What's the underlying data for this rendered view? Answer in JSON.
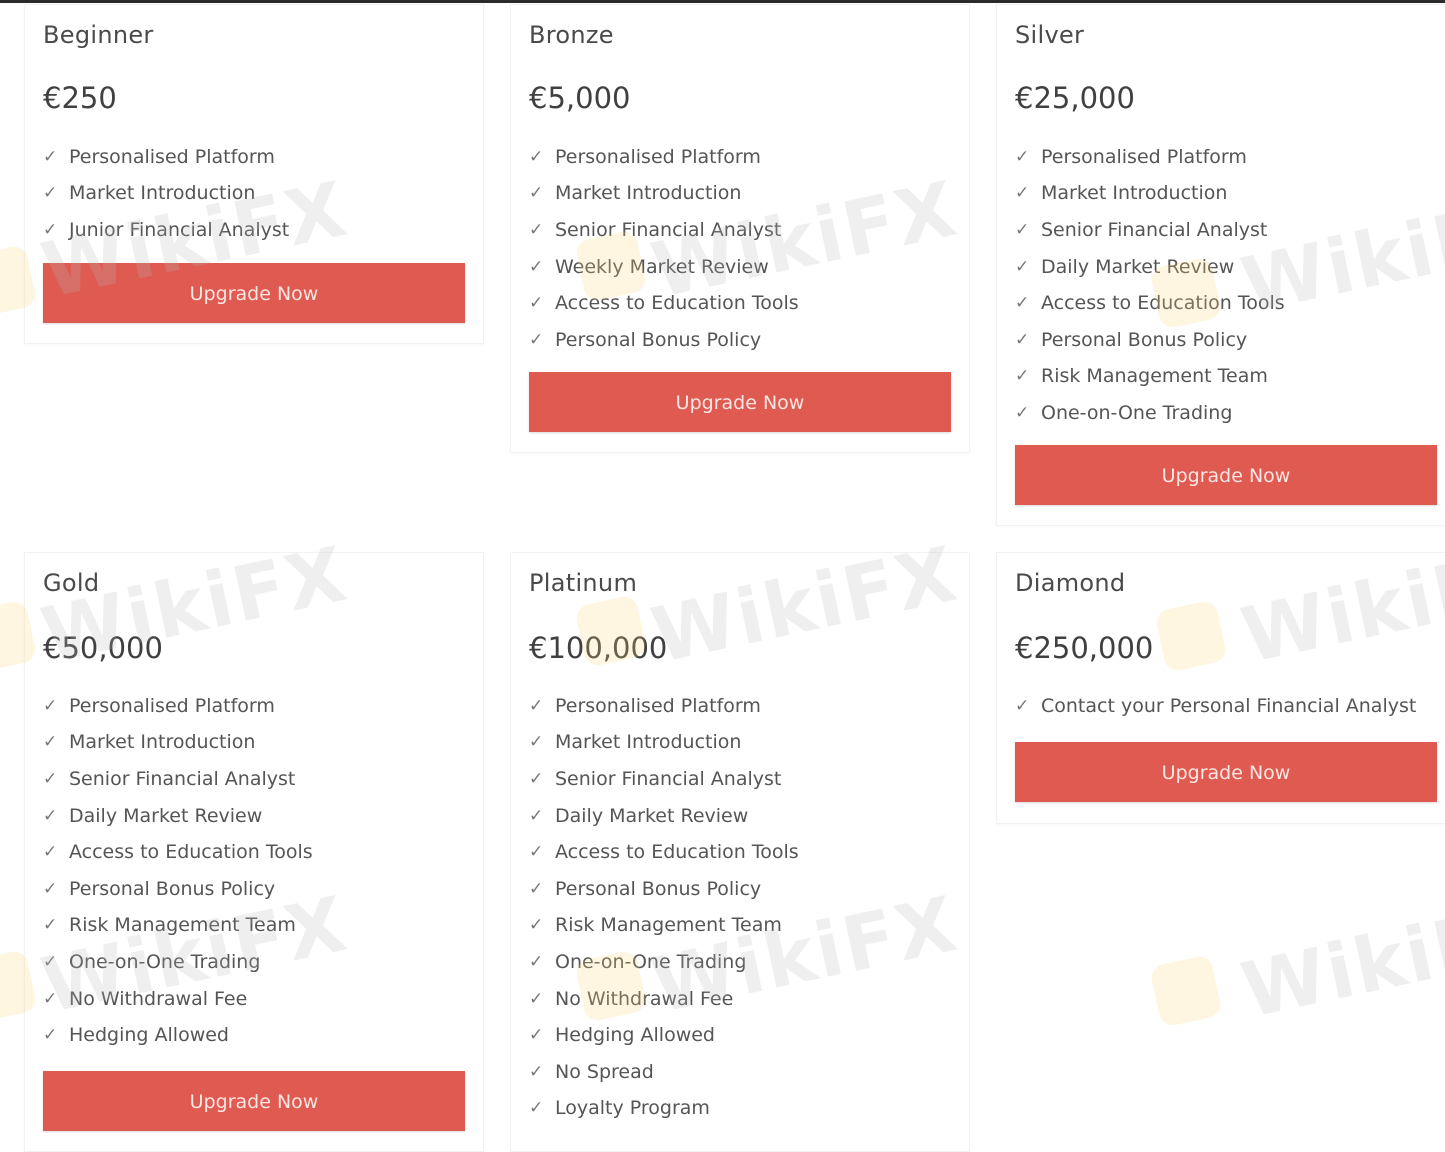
{
  "accent_color": "#df5b52",
  "watermark_text": "WikiFX",
  "check_glyph": "✓",
  "plans": [
    {
      "name": "Beginner",
      "price": "€250",
      "features": [
        "Personalised Platform",
        "Market Introduction",
        "Junior Financial Analyst"
      ],
      "button_label": "Upgrade Now"
    },
    {
      "name": "Bronze",
      "price": "€5,000",
      "features": [
        "Personalised Platform",
        "Market Introduction",
        "Senior Financial Analyst",
        "Weekly Market Review",
        "Access to Education Tools",
        "Personal Bonus Policy"
      ],
      "button_label": "Upgrade Now"
    },
    {
      "name": "Silver",
      "price": "€25,000",
      "features": [
        "Personalised Platform",
        "Market Introduction",
        "Senior Financial Analyst",
        "Daily Market Review",
        "Access to Education Tools",
        "Personal Bonus Policy",
        "Risk Management Team",
        "One-on-One Trading"
      ],
      "button_label": "Upgrade Now"
    },
    {
      "name": "Gold",
      "price": "€50,000",
      "features": [
        "Personalised Platform",
        "Market Introduction",
        "Senior Financial Analyst",
        "Daily Market Review",
        "Access to Education Tools",
        "Personal Bonus Policy",
        "Risk Management Team",
        "One-on-One Trading",
        "No Withdrawal Fee",
        "Hedging Allowed"
      ],
      "button_label": "Upgrade Now"
    },
    {
      "name": "Platinum",
      "price": "€100,000",
      "features": [
        "Personalised Platform",
        "Market Introduction",
        "Senior Financial Analyst",
        "Daily Market Review",
        "Access to Education Tools",
        "Personal Bonus Policy",
        "Risk Management Team",
        "One-on-One Trading",
        "No Withdrawal Fee",
        "Hedging Allowed",
        "No Spread",
        "Loyalty Program"
      ],
      "button_label": ""
    },
    {
      "name": "Diamond",
      "price": "€250,000",
      "features": [
        "Contact your Personal Financial Analyst"
      ],
      "button_label": "Upgrade Now"
    }
  ]
}
